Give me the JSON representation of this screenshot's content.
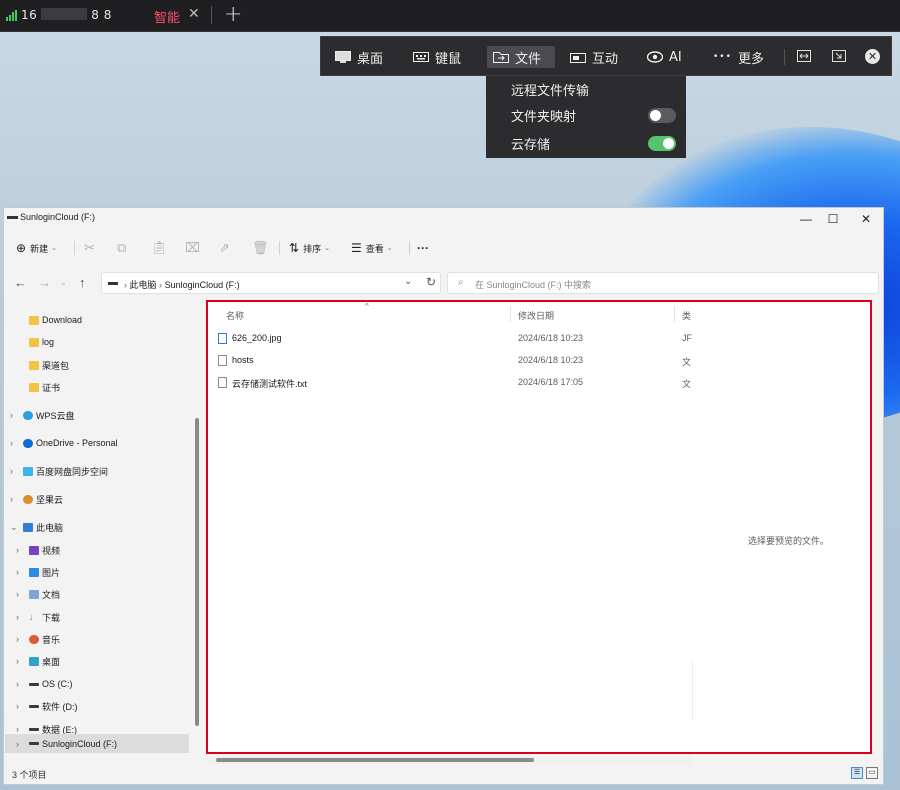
{
  "client": {
    "connection_id_prefix": "16",
    "connection_id_suffix": "8 8",
    "mode_label": "智能",
    "close_tab_glyph": "✕",
    "add_tab_glyph": "+",
    "signal_color": "#3fcf5a",
    "mode_color": "#ff4f6b"
  },
  "toolbar": {
    "items": [
      {
        "label": "桌面",
        "icon": "monitor-icon"
      },
      {
        "label": "键鼠",
        "icon": "keyboard-icon"
      },
      {
        "label": "文件",
        "icon": "folder-icon"
      },
      {
        "label": "互动",
        "icon": "camera-icon"
      },
      {
        "label": "AI",
        "icon": "eye-icon"
      },
      {
        "label": "更多",
        "icon": "more-dots-icon"
      }
    ],
    "more_glyph": "•••",
    "close_glyph": "✕"
  },
  "file_menu": {
    "items": [
      {
        "label": "远程文件传输"
      },
      {
        "label": "文件夹映射",
        "toggle": false
      },
      {
        "label": "云存储",
        "toggle": true
      }
    ],
    "toggle_on_color": "#56c46a"
  },
  "explorer": {
    "title": "SunloginCloud (F:)",
    "window_buttons": {
      "minimize": "—",
      "maximize": "☐",
      "close": "✕"
    },
    "commands": {
      "new_label": "新建",
      "sort_label": "排序",
      "view_label": "查看",
      "more_glyph": "···"
    },
    "breadcrumb": [
      "此电脑",
      "SunloginCloud (F:)"
    ],
    "search_placeholder": "在 SunloginCloud (F:) 中搜索",
    "sidebar": [
      {
        "label": "Download",
        "icon": "folder-icon"
      },
      {
        "label": "log",
        "icon": "folder-icon"
      },
      {
        "label": "渠道包",
        "icon": "folder-icon"
      },
      {
        "label": "证书",
        "icon": "folder-icon"
      },
      {
        "label": "WPS云盘",
        "icon": "cloud-icon"
      },
      {
        "label": "OneDrive - Personal",
        "icon": "onedrive-icon"
      },
      {
        "label": "百度网盘同步空间",
        "icon": "baidu-icon"
      },
      {
        "label": "坚果云",
        "icon": "nut-icon"
      },
      {
        "label": "此电脑",
        "icon": "computer-icon"
      },
      {
        "label": "视频",
        "icon": "video-icon"
      },
      {
        "label": "图片",
        "icon": "picture-icon"
      },
      {
        "label": "文档",
        "icon": "document-icon"
      },
      {
        "label": "下载",
        "icon": "download-icon"
      },
      {
        "label": "音乐",
        "icon": "music-icon"
      },
      {
        "label": "桌面",
        "icon": "desktop-icon"
      },
      {
        "label": "OS (C:)",
        "icon": "drive-icon"
      },
      {
        "label": "软件 (D:)",
        "icon": "drive-icon"
      },
      {
        "label": "数据 (E:)",
        "icon": "drive-icon"
      },
      {
        "label": "SunloginCloud (F:)",
        "icon": "drive-icon"
      }
    ],
    "columns": {
      "name": "名称",
      "modified": "修改日期",
      "type": "类"
    },
    "files": [
      {
        "name": "626_200.jpg",
        "modified": "2024/6/18 10:23",
        "type": "JF",
        "icon": "image-file-icon"
      },
      {
        "name": "hosts",
        "modified": "2024/6/18 10:23",
        "type": "文",
        "icon": "file-icon"
      },
      {
        "name": "云存储测试软件.txt",
        "modified": "2024/6/18 17:05",
        "type": "文",
        "icon": "text-file-icon"
      }
    ],
    "preview_text": "选择要预览的文件。",
    "status_text": "3 个项目",
    "highlight_color": "#d9001b"
  }
}
